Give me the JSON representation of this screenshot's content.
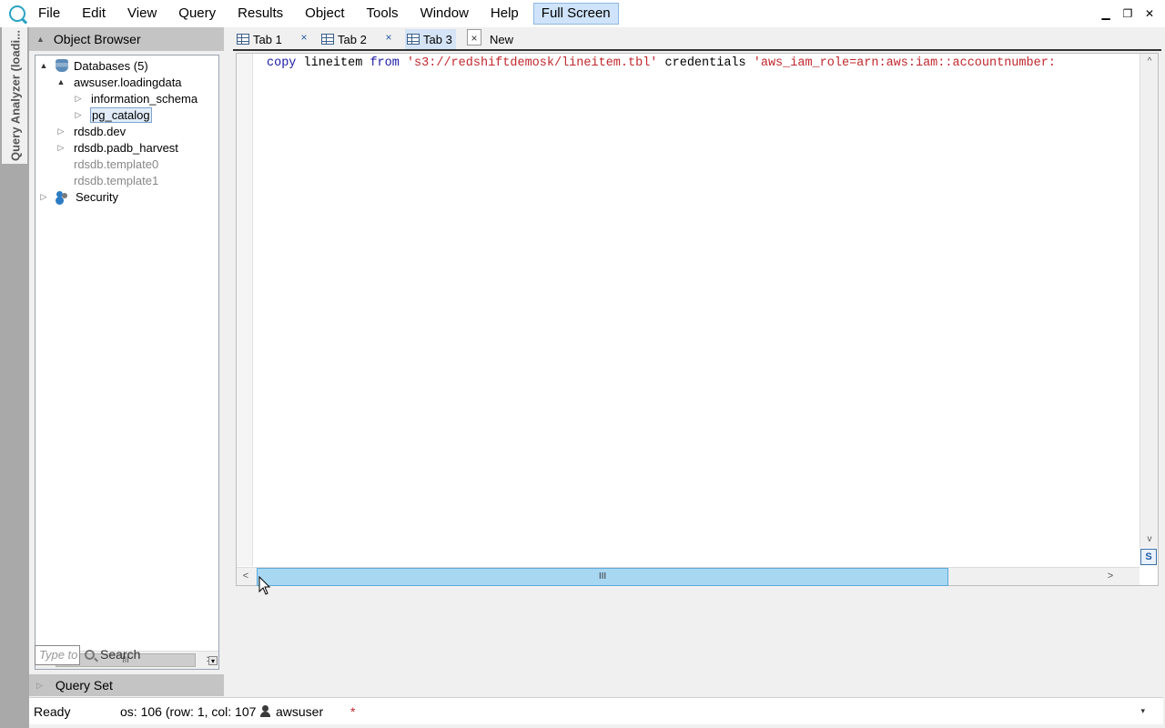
{
  "menubar": {
    "items": [
      "File",
      "Edit",
      "View",
      "Query",
      "Results",
      "Object",
      "Tools",
      "Window",
      "Help"
    ],
    "fullscreen_label": "Full Screen"
  },
  "sidebar": {
    "vertical_tab_label": "Query Analyzer (loadi..."
  },
  "object_browser": {
    "title": "Object Browser",
    "tree": {
      "databases": "Databases (5)",
      "awsuser": "awsuser.loadingdata",
      "information_schema": "information_schema",
      "pg_catalog": "pg_catalog",
      "rdsdb_dev": "rdsdb.dev",
      "rdsdb_padb_harvest": "rdsdb.padb_harvest",
      "rdsdb_template0": "rdsdb.template0",
      "rdsdb_template1": "rdsdb.template1",
      "security": "Security"
    },
    "search_placeholder": "Type to",
    "search_label": "Search"
  },
  "query_set": {
    "title": "Query Set"
  },
  "tabs": [
    {
      "label": "Tab 1"
    },
    {
      "label": "Tab 2"
    },
    {
      "label": "Tab 3"
    },
    {
      "label": "New"
    }
  ],
  "editor": {
    "tokens": {
      "copy": "copy",
      "lineitem": "lineitem",
      "from": "from",
      "s3path": "'s3://redshiftdemosk/lineitem.tbl'",
      "credentials": "credentials",
      "role": "'aws_iam_role=arn:aws:iam::accountnumber:"
    }
  },
  "statusbar": {
    "ready": "Ready",
    "position": "os: 106 (row: 1, col: 107",
    "user": "awsuser",
    "modified": "*"
  },
  "icons": {
    "expand_open": "▲",
    "expand_closed": "▷",
    "scroll_left": "<",
    "scroll_right": ">",
    "scroll_up": "^",
    "scroll_down": "v",
    "thumb_grip": "III",
    "close": "×",
    "side": "S",
    "dropdown": "▾"
  },
  "colors": {
    "keyword": "#1a1aa6",
    "string": "#c0272d",
    "scroll_thumb": "#a8d7f2",
    "fullscreen_bg": "#cfe4fa"
  }
}
